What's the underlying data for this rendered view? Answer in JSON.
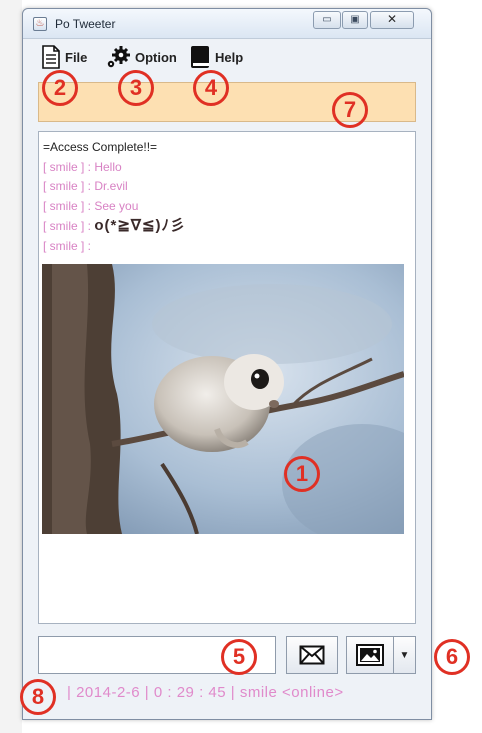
{
  "window": {
    "title": "Po Tweeter"
  },
  "menu": {
    "file": "File",
    "option": "Option",
    "help": "Help"
  },
  "chat": {
    "system": "=Access Complete!!=",
    "messages": [
      {
        "user": "[ smile ] : ",
        "text": "Hello"
      },
      {
        "user": "[ smile ] : ",
        "text": "Dr.evil"
      },
      {
        "user": "[ smile ] : ",
        "text": "See you"
      },
      {
        "user": "[ smile ] : ",
        "text": "o(*≧∇≦)ﾉ彡"
      },
      {
        "user": "[ smile ] : ",
        "text": ""
      }
    ]
  },
  "input": {
    "value": "",
    "placeholder": ""
  },
  "status": {
    "date": "2014-2-6",
    "time": "0 : 29 : 45",
    "user": "smile",
    "state": "<online>",
    "separator": "|"
  },
  "callouts": [
    "1",
    "2",
    "3",
    "4",
    "5",
    "6",
    "7",
    "8"
  ],
  "colors": {
    "notice": "#fde0b2",
    "chat_user": "#d882c4",
    "callout": "#e03024"
  }
}
